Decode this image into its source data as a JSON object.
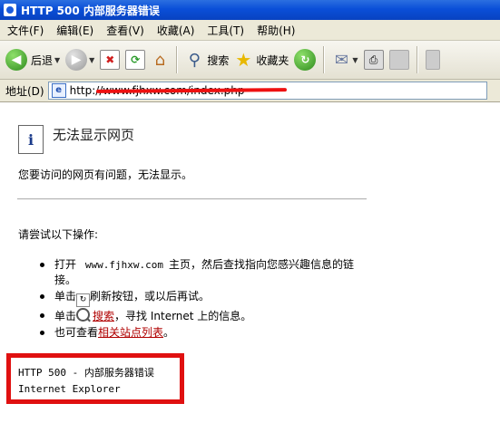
{
  "window": {
    "title": "HTTP 500 内部服务器错误"
  },
  "menu": [
    "文件(F)",
    "编辑(E)",
    "查看(V)",
    "收藏(A)",
    "工具(T)",
    "帮助(H)"
  ],
  "toolbar": {
    "back_label": "后退",
    "search_label": "搜索",
    "favorites_label": "收藏夹"
  },
  "address": {
    "label": "地址(D)",
    "url": "http://www.fjhxw.com/index.php"
  },
  "error": {
    "title": "无法显示网页",
    "description": "您要访问的网页有问题，无法显示。",
    "try_label": "请尝试以下操作:",
    "items": {
      "open_prefix": "打开",
      "site": "www.fjhxw.com",
      "open_suffix": "主页，然后查找指向您感兴趣信息的链接。",
      "click_prefix": "单击",
      "refresh_text": "刷新按钮，或以后再试。",
      "search_prefix": "单击",
      "search_link": "搜索",
      "search_suffix": "，寻找 Internet 上的信息。",
      "related_prefix": "也可查看",
      "related_link": "相关站点列表",
      "related_suffix": "。"
    },
    "status_code": "HTTP 500 - 内部服务器错误",
    "browser": "Internet Explorer"
  },
  "colors": {
    "titlebar": "#0a4fd8",
    "highlight": "#e01010",
    "link": "#b00000"
  }
}
